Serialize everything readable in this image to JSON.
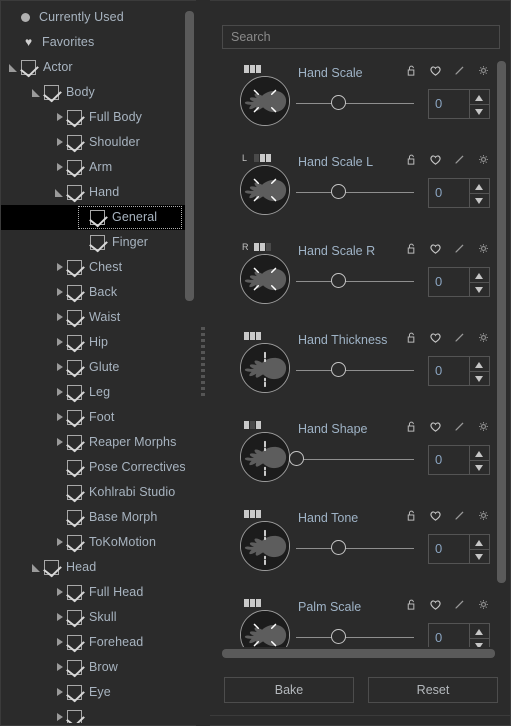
{
  "tree": {
    "items": [
      {
        "label": "Currently Used",
        "depth": 0,
        "icon": "dot-icon",
        "twisty": "none",
        "checkbox": false,
        "selected": false
      },
      {
        "label": "Favorites",
        "depth": 0,
        "icon": "heart-icon",
        "twisty": "none",
        "checkbox": false,
        "selected": false
      },
      {
        "label": "Actor",
        "depth": 0,
        "icon": "",
        "twisty": "open",
        "checkbox": true,
        "selected": false
      },
      {
        "label": "Body",
        "depth": 1,
        "icon": "",
        "twisty": "open",
        "checkbox": true,
        "selected": false
      },
      {
        "label": "Full Body",
        "depth": 2,
        "icon": "",
        "twisty": "closed",
        "checkbox": true,
        "selected": false
      },
      {
        "label": "Shoulder",
        "depth": 2,
        "icon": "",
        "twisty": "closed",
        "checkbox": true,
        "selected": false
      },
      {
        "label": "Arm",
        "depth": 2,
        "icon": "",
        "twisty": "closed",
        "checkbox": true,
        "selected": false
      },
      {
        "label": "Hand",
        "depth": 2,
        "icon": "",
        "twisty": "open",
        "checkbox": true,
        "selected": false
      },
      {
        "label": "General",
        "depth": 3,
        "icon": "",
        "twisty": "none",
        "checkbox": true,
        "selected": true
      },
      {
        "label": "Finger",
        "depth": 3,
        "icon": "",
        "twisty": "none",
        "checkbox": true,
        "selected": false
      },
      {
        "label": "Chest",
        "depth": 2,
        "icon": "",
        "twisty": "closed",
        "checkbox": true,
        "selected": false
      },
      {
        "label": "Back",
        "depth": 2,
        "icon": "",
        "twisty": "closed",
        "checkbox": true,
        "selected": false
      },
      {
        "label": "Waist",
        "depth": 2,
        "icon": "",
        "twisty": "closed",
        "checkbox": true,
        "selected": false
      },
      {
        "label": "Hip",
        "depth": 2,
        "icon": "",
        "twisty": "closed",
        "checkbox": true,
        "selected": false
      },
      {
        "label": "Glute",
        "depth": 2,
        "icon": "",
        "twisty": "closed",
        "checkbox": true,
        "selected": false
      },
      {
        "label": "Leg",
        "depth": 2,
        "icon": "",
        "twisty": "closed",
        "checkbox": true,
        "selected": false
      },
      {
        "label": "Foot",
        "depth": 2,
        "icon": "",
        "twisty": "closed",
        "checkbox": true,
        "selected": false
      },
      {
        "label": "Reaper Morphs",
        "depth": 2,
        "icon": "",
        "twisty": "closed",
        "checkbox": true,
        "selected": false
      },
      {
        "label": "Pose Correctives",
        "depth": 2,
        "icon": "",
        "twisty": "none",
        "checkbox": true,
        "selected": false
      },
      {
        "label": "Kohlrabi Studio",
        "depth": 2,
        "icon": "",
        "twisty": "none",
        "checkbox": true,
        "selected": false
      },
      {
        "label": "Base Morph",
        "depth": 2,
        "icon": "",
        "twisty": "none",
        "checkbox": true,
        "selected": false
      },
      {
        "label": "ToKoMotion",
        "depth": 2,
        "icon": "",
        "twisty": "closed",
        "checkbox": true,
        "selected": false
      },
      {
        "label": "Head",
        "depth": 1,
        "icon": "",
        "twisty": "open",
        "checkbox": true,
        "selected": false
      },
      {
        "label": "Full Head",
        "depth": 2,
        "icon": "",
        "twisty": "closed",
        "checkbox": true,
        "selected": false
      },
      {
        "label": "Skull",
        "depth": 2,
        "icon": "",
        "twisty": "closed",
        "checkbox": true,
        "selected": false
      },
      {
        "label": "Forehead",
        "depth": 2,
        "icon": "",
        "twisty": "closed",
        "checkbox": true,
        "selected": false
      },
      {
        "label": "Brow",
        "depth": 2,
        "icon": "",
        "twisty": "closed",
        "checkbox": true,
        "selected": false
      },
      {
        "label": "Eye",
        "depth": 2,
        "icon": "",
        "twisty": "closed",
        "checkbox": true,
        "selected": false
      },
      {
        "label": "",
        "depth": 2,
        "icon": "",
        "twisty": "closed",
        "checkbox": true,
        "selected": false
      }
    ]
  },
  "search": {
    "value": "",
    "placeholder": "Search"
  },
  "parameters": {
    "rows": [
      {
        "label": "Hand Scale",
        "side": "",
        "value": "0",
        "knob_pct": 36,
        "segments": [
          1,
          1,
          1
        ],
        "thumb": "hand-scale"
      },
      {
        "label": "Hand Scale L",
        "side": "L",
        "value": "0",
        "knob_pct": 36,
        "segments": [
          0,
          1,
          1
        ],
        "thumb": "hand-scale"
      },
      {
        "label": "Hand Scale R",
        "side": "R",
        "value": "0",
        "knob_pct": 36,
        "segments": [
          1,
          1,
          0
        ],
        "thumb": "hand-scale"
      },
      {
        "label": "Hand Thickness",
        "side": "",
        "value": "0",
        "knob_pct": 36,
        "segments": [
          1,
          1,
          1
        ],
        "thumb": "hand-thickness"
      },
      {
        "label": "Hand Shape",
        "side": "",
        "value": "0",
        "knob_pct": 0,
        "segments": [
          1,
          0,
          1
        ],
        "thumb": "hand-thickness"
      },
      {
        "label": "Hand Tone",
        "side": "",
        "value": "0",
        "knob_pct": 36,
        "segments": [
          1,
          1,
          1
        ],
        "thumb": "hand-thickness"
      },
      {
        "label": "Palm Scale",
        "side": "",
        "value": "0",
        "knob_pct": 36,
        "segments": [
          1,
          1,
          1
        ],
        "thumb": "hand-scale"
      }
    ],
    "icons": [
      "unlock-icon",
      "heart-icon",
      "pencil-icon",
      "gear-icon"
    ]
  },
  "footer": {
    "bake_label": "Bake",
    "reset_label": "Reset"
  },
  "colors": {
    "background": "#2b2b2b",
    "panel_border": "#3b3b3b",
    "label_text": "#9fb3c6",
    "tree_text": "#a8b4c0",
    "value_text": "#8aa4c0",
    "scrollbar": "#5a5a5a",
    "selection": "#000000"
  }
}
